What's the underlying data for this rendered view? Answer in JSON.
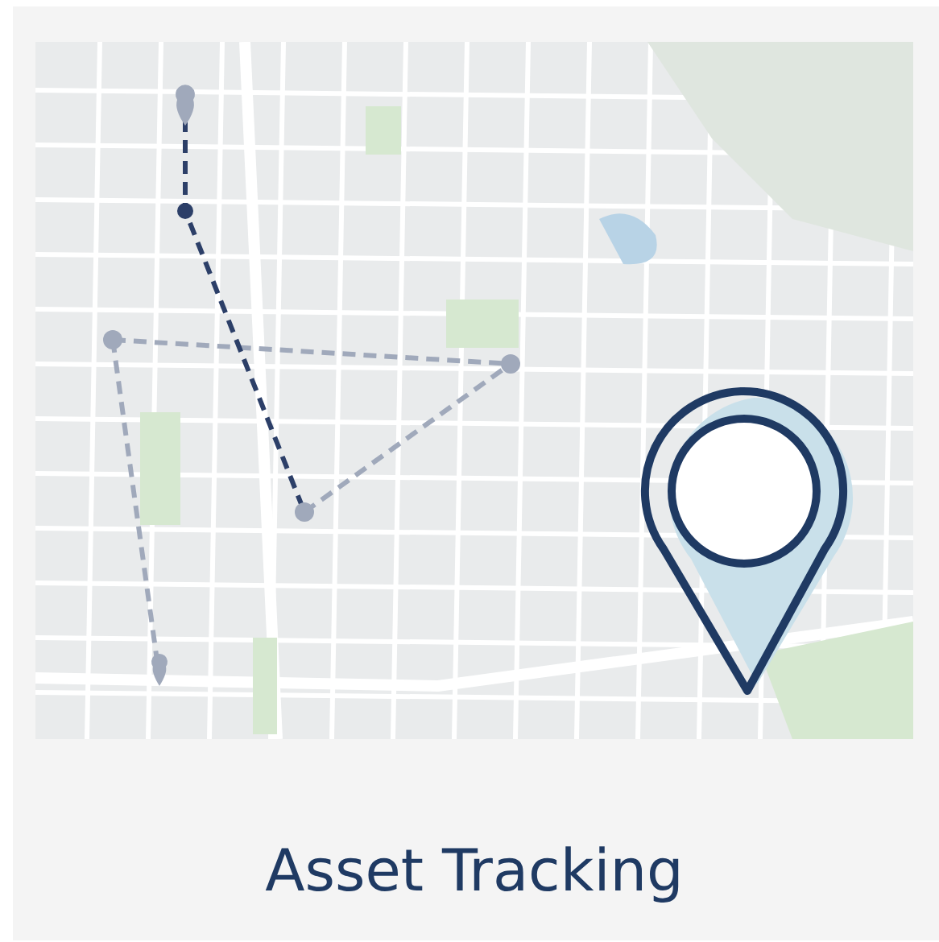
{
  "card": {
    "title": "Asset Tracking"
  }
}
